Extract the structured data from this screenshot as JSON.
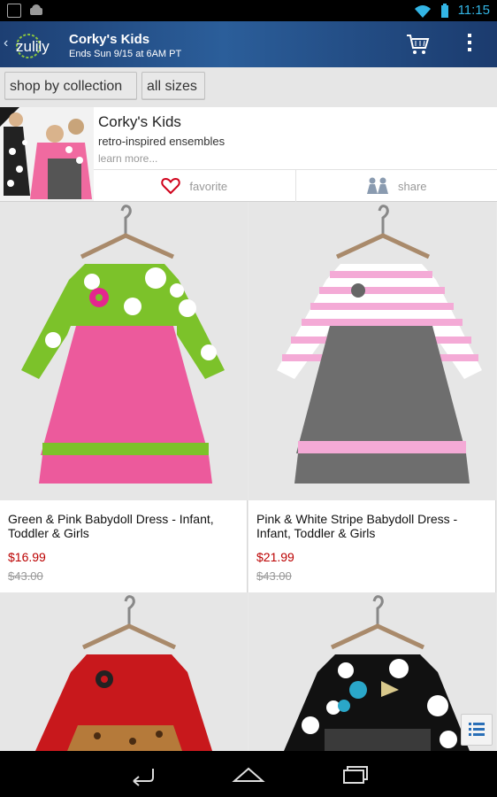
{
  "status_bar": {
    "time": "11:15"
  },
  "action_bar": {
    "title": "Corky's Kids",
    "subtitle": "Ends Sun 9/15 at 6AM PT",
    "logo_text": "zulily"
  },
  "filters": {
    "collection": "shop by collection",
    "sizes": "all sizes"
  },
  "event": {
    "name": "Corky's Kids",
    "description": "retro-inspired ensembles",
    "learn_more": "learn more...",
    "favorite": "favorite",
    "share": "share"
  },
  "products": [
    {
      "title": "Green & Pink Babydoll Dress - Infant, Toddler & Girls",
      "price": "$16.99",
      "original_price": "$43.00"
    },
    {
      "title": "Pink & White Stripe Babydoll Dress - Infant, Toddler & Girls",
      "price": "$21.99",
      "original_price": "$43.00"
    }
  ],
  "colors": {
    "accent_blue": "#33b5e5",
    "price_red": "#b00000",
    "brand_blue": "#1d3f73"
  }
}
